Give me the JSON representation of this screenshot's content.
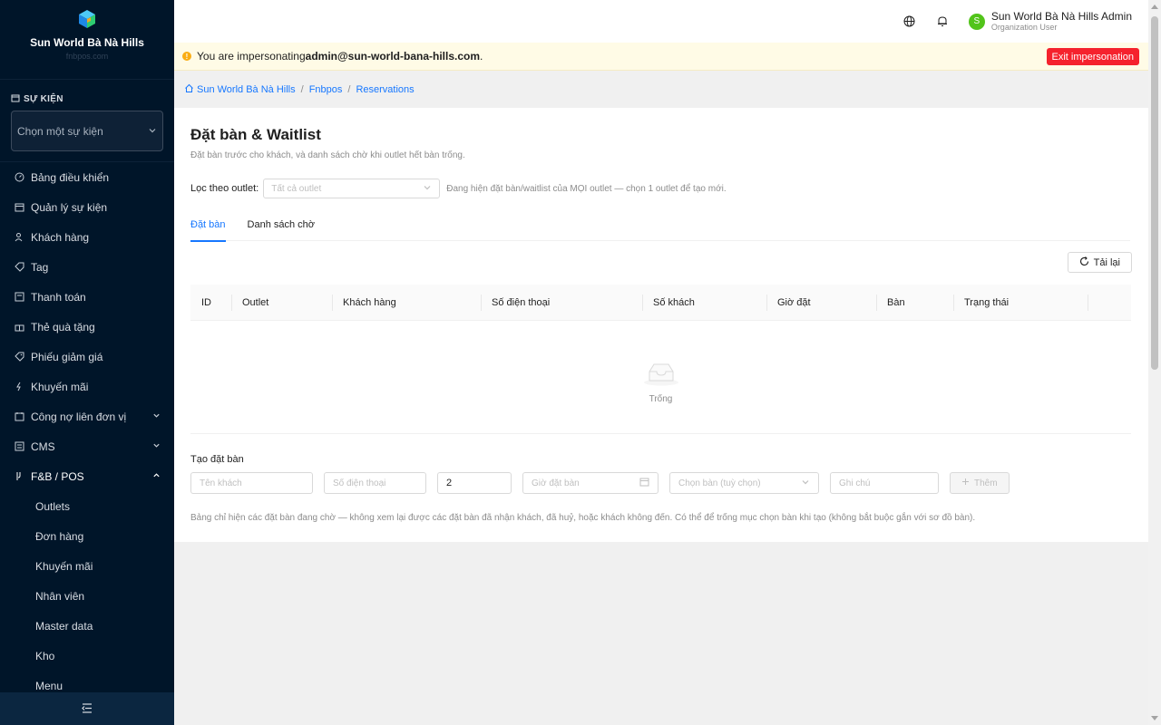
{
  "sidebar": {
    "brand_name": "Sun World Bà Nà Hills",
    "brand_sub": "fnbpos.com",
    "section_label": "SỰ KIỆN",
    "event_select_placeholder": "Chọn một sự kiện",
    "items": [
      {
        "label": "Bảng điều khiển",
        "icon": "dashboard-icon"
      },
      {
        "label": "Quản lý sự kiện",
        "icon": "calendar-icon"
      },
      {
        "label": "Khách hàng",
        "icon": "users-icon"
      },
      {
        "label": "Tag",
        "icon": "tag-icon"
      },
      {
        "label": "Thanh toán",
        "icon": "payment-icon"
      },
      {
        "label": "Thẻ quà tặng",
        "icon": "gift-icon"
      },
      {
        "label": "Phiếu giảm giá",
        "icon": "coupon-icon"
      },
      {
        "label": "Khuyến mãi",
        "icon": "promotion-icon"
      },
      {
        "label": "Công nợ liên đơn vị",
        "icon": "debt-icon"
      },
      {
        "label": "CMS",
        "icon": "cms-icon"
      },
      {
        "label": "F&B / POS",
        "icon": "pos-icon"
      }
    ],
    "sub_items": [
      "Outlets",
      "Đơn hàng",
      "Khuyến mãi",
      "Nhân viên",
      "Master data",
      "Kho",
      "Menu"
    ]
  },
  "header": {
    "user_name": "Sun World Bà Nà Hills Admin",
    "user_role": "Organization User",
    "avatar_letter": "S"
  },
  "banner": {
    "prefix": "You are impersonating ",
    "email": "admin@sun-world-bana-hills.com",
    "suffix": ".",
    "exit_label": "Exit impersonation"
  },
  "breadcrumb": [
    "Sun World Bà Nà Hills",
    "Fnbpos",
    "Reservations"
  ],
  "page": {
    "title": "Đặt bàn & Waitlist",
    "subtitle": "Đặt bàn trước cho khách, và danh sách chờ khi outlet hết bàn trống.",
    "filter_label": "Lọc theo outlet:",
    "filter_placeholder": "Tất cả outlet",
    "filter_hint": "Đang hiện đặt bàn/waitlist của MỌI outlet — chọn 1 outlet để tạo mới.",
    "tabs": [
      "Đặt bàn",
      "Danh sách chờ"
    ],
    "reload_label": "Tải lại",
    "columns": [
      "ID",
      "Outlet",
      "Khách hàng",
      "Số điện thoại",
      "Số khách",
      "Giờ đặt",
      "Bàn",
      "Trạng thái"
    ],
    "empty_text": "Trống",
    "create_title": "Tạo đặt bàn",
    "create": {
      "guest_placeholder": "Tên khách",
      "phone_placeholder": "Số điện thoại",
      "party_size": "2",
      "time_placeholder": "Giờ đặt bàn",
      "table_placeholder": "Chọn bàn (tuỳ chọn)",
      "note_placeholder": "Ghi chú",
      "add_label": "Thêm"
    },
    "note": "Bảng chỉ hiện các đặt bàn đang chờ — không xem lại được các đặt bàn đã nhận khách, đã huỷ, hoặc khách không đến. Có thể để trống mục chọn bàn khi tạo (không bắt buộc gắn với sơ đồ bàn)."
  },
  "colors": {
    "sidebar_bg": "#001529",
    "primary": "#1677ff",
    "danger": "#f5222d",
    "avatar": "#52c41a",
    "warning_bg": "#fffbe6"
  }
}
